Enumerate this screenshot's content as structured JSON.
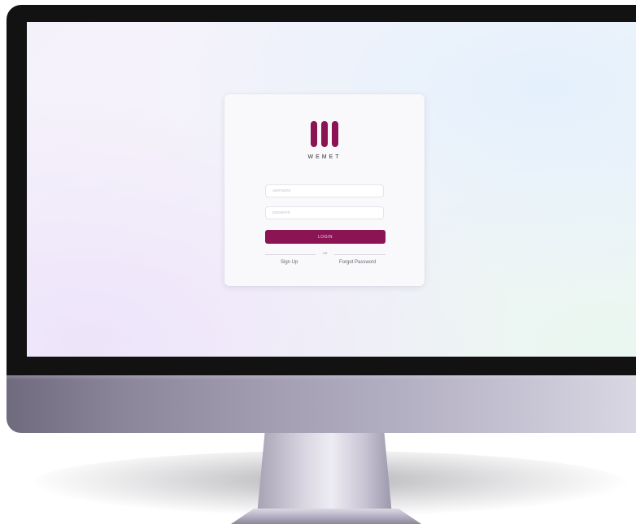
{
  "brand": {
    "name": "WEMET",
    "accent_color": "#8a1454",
    "logo_icon": "three-vertical-bars-logo"
  },
  "login_form": {
    "username_placeholder": "username",
    "password_placeholder": "password",
    "login_label": "LOGIN",
    "divider_text": "OR",
    "signup_label": "Sign Up",
    "forgot_label": "Forgot Password"
  }
}
